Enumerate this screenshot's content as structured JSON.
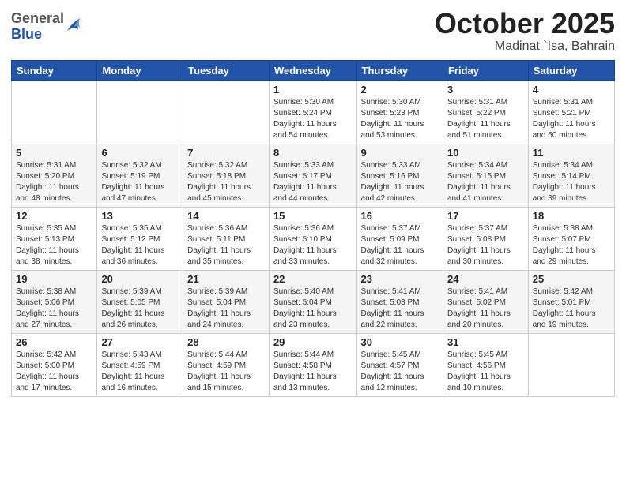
{
  "header": {
    "logo": {
      "general": "General",
      "blue": "Blue"
    },
    "title": "October 2025",
    "location": "Madinat `Isa, Bahrain"
  },
  "weekdays": [
    "Sunday",
    "Monday",
    "Tuesday",
    "Wednesday",
    "Thursday",
    "Friday",
    "Saturday"
  ],
  "weeks": [
    [
      {
        "day": "",
        "info": ""
      },
      {
        "day": "",
        "info": ""
      },
      {
        "day": "",
        "info": ""
      },
      {
        "day": "1",
        "info": "Sunrise: 5:30 AM\nSunset: 5:24 PM\nDaylight: 11 hours\nand 54 minutes."
      },
      {
        "day": "2",
        "info": "Sunrise: 5:30 AM\nSunset: 5:23 PM\nDaylight: 11 hours\nand 53 minutes."
      },
      {
        "day": "3",
        "info": "Sunrise: 5:31 AM\nSunset: 5:22 PM\nDaylight: 11 hours\nand 51 minutes."
      },
      {
        "day": "4",
        "info": "Sunrise: 5:31 AM\nSunset: 5:21 PM\nDaylight: 11 hours\nand 50 minutes."
      }
    ],
    [
      {
        "day": "5",
        "info": "Sunrise: 5:31 AM\nSunset: 5:20 PM\nDaylight: 11 hours\nand 48 minutes."
      },
      {
        "day": "6",
        "info": "Sunrise: 5:32 AM\nSunset: 5:19 PM\nDaylight: 11 hours\nand 47 minutes."
      },
      {
        "day": "7",
        "info": "Sunrise: 5:32 AM\nSunset: 5:18 PM\nDaylight: 11 hours\nand 45 minutes."
      },
      {
        "day": "8",
        "info": "Sunrise: 5:33 AM\nSunset: 5:17 PM\nDaylight: 11 hours\nand 44 minutes."
      },
      {
        "day": "9",
        "info": "Sunrise: 5:33 AM\nSunset: 5:16 PM\nDaylight: 11 hours\nand 42 minutes."
      },
      {
        "day": "10",
        "info": "Sunrise: 5:34 AM\nSunset: 5:15 PM\nDaylight: 11 hours\nand 41 minutes."
      },
      {
        "day": "11",
        "info": "Sunrise: 5:34 AM\nSunset: 5:14 PM\nDaylight: 11 hours\nand 39 minutes."
      }
    ],
    [
      {
        "day": "12",
        "info": "Sunrise: 5:35 AM\nSunset: 5:13 PM\nDaylight: 11 hours\nand 38 minutes."
      },
      {
        "day": "13",
        "info": "Sunrise: 5:35 AM\nSunset: 5:12 PM\nDaylight: 11 hours\nand 36 minutes."
      },
      {
        "day": "14",
        "info": "Sunrise: 5:36 AM\nSunset: 5:11 PM\nDaylight: 11 hours\nand 35 minutes."
      },
      {
        "day": "15",
        "info": "Sunrise: 5:36 AM\nSunset: 5:10 PM\nDaylight: 11 hours\nand 33 minutes."
      },
      {
        "day": "16",
        "info": "Sunrise: 5:37 AM\nSunset: 5:09 PM\nDaylight: 11 hours\nand 32 minutes."
      },
      {
        "day": "17",
        "info": "Sunrise: 5:37 AM\nSunset: 5:08 PM\nDaylight: 11 hours\nand 30 minutes."
      },
      {
        "day": "18",
        "info": "Sunrise: 5:38 AM\nSunset: 5:07 PM\nDaylight: 11 hours\nand 29 minutes."
      }
    ],
    [
      {
        "day": "19",
        "info": "Sunrise: 5:38 AM\nSunset: 5:06 PM\nDaylight: 11 hours\nand 27 minutes."
      },
      {
        "day": "20",
        "info": "Sunrise: 5:39 AM\nSunset: 5:05 PM\nDaylight: 11 hours\nand 26 minutes."
      },
      {
        "day": "21",
        "info": "Sunrise: 5:39 AM\nSunset: 5:04 PM\nDaylight: 11 hours\nand 24 minutes."
      },
      {
        "day": "22",
        "info": "Sunrise: 5:40 AM\nSunset: 5:04 PM\nDaylight: 11 hours\nand 23 minutes."
      },
      {
        "day": "23",
        "info": "Sunrise: 5:41 AM\nSunset: 5:03 PM\nDaylight: 11 hours\nand 22 minutes."
      },
      {
        "day": "24",
        "info": "Sunrise: 5:41 AM\nSunset: 5:02 PM\nDaylight: 11 hours\nand 20 minutes."
      },
      {
        "day": "25",
        "info": "Sunrise: 5:42 AM\nSunset: 5:01 PM\nDaylight: 11 hours\nand 19 minutes."
      }
    ],
    [
      {
        "day": "26",
        "info": "Sunrise: 5:42 AM\nSunset: 5:00 PM\nDaylight: 11 hours\nand 17 minutes."
      },
      {
        "day": "27",
        "info": "Sunrise: 5:43 AM\nSunset: 4:59 PM\nDaylight: 11 hours\nand 16 minutes."
      },
      {
        "day": "28",
        "info": "Sunrise: 5:44 AM\nSunset: 4:59 PM\nDaylight: 11 hours\nand 15 minutes."
      },
      {
        "day": "29",
        "info": "Sunrise: 5:44 AM\nSunset: 4:58 PM\nDaylight: 11 hours\nand 13 minutes."
      },
      {
        "day": "30",
        "info": "Sunrise: 5:45 AM\nSunset: 4:57 PM\nDaylight: 11 hours\nand 12 minutes."
      },
      {
        "day": "31",
        "info": "Sunrise: 5:45 AM\nSunset: 4:56 PM\nDaylight: 11 hours\nand 10 minutes."
      },
      {
        "day": "",
        "info": ""
      }
    ]
  ]
}
